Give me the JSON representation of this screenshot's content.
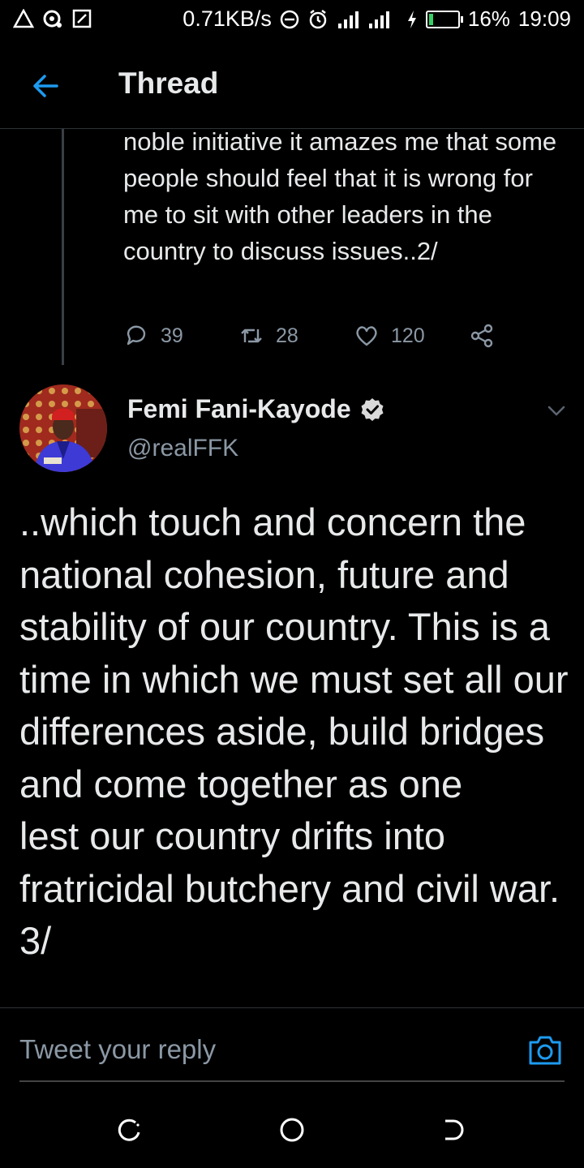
{
  "status_bar": {
    "net_speed": "0.71KB/s",
    "battery_percent": "16%",
    "time": "19:09",
    "battery_level": 0.16,
    "icons": [
      "warning-icon",
      "notification-icon",
      "screenshot-icon",
      "do-not-disturb-icon",
      "alarm-icon",
      "signal-icon",
      "charging-icon",
      "battery-icon"
    ]
  },
  "header": {
    "title": "Thread",
    "back_icon": "arrow-left-icon"
  },
  "previous_tweet": {
    "text": "noble initiative it amazes me that some people should feel that it is wrong for me to sit with other leaders in the country to discuss issues..2/",
    "replies": "39",
    "retweets": "28",
    "likes": "120"
  },
  "tweet": {
    "name": "Femi Fani-Kayode",
    "handle": "@realFFK",
    "verified": true,
    "text": "..which touch and concern the national cohesion, future and stability of our country. This is a time in which we must set all our differences aside, build bridges and come together as one\nlest our country drifts into fratricidal butchery and civil war. 3/"
  },
  "reply": {
    "placeholder": "Tweet your reply"
  },
  "colors": {
    "accent": "#1d9bf0",
    "text": "#e7e9ea",
    "muted": "#8b98a5",
    "divider": "#2f3336",
    "background": "#000000"
  }
}
